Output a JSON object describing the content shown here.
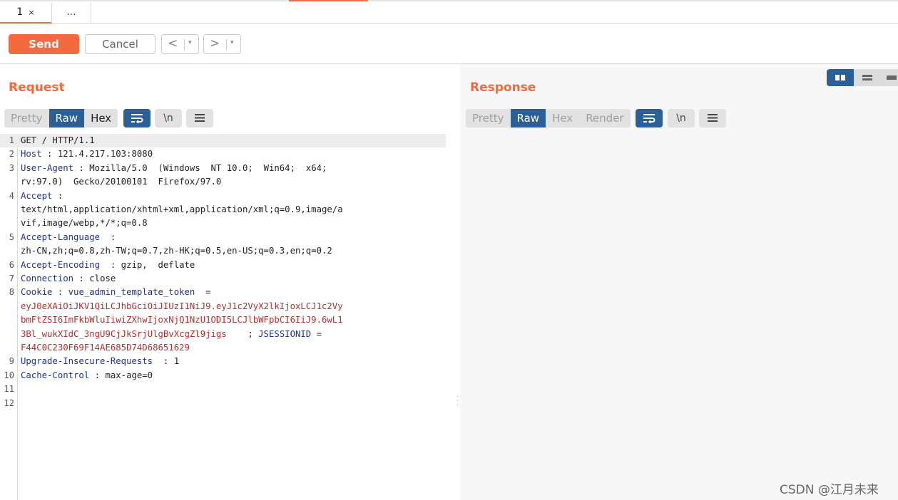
{
  "tabs": [
    {
      "label": "1",
      "close": "×"
    },
    {
      "label": "…"
    }
  ],
  "toolbar": {
    "send_label": "Send",
    "cancel_label": "Cancel",
    "prev_arrow": "<",
    "next_arrow": ">",
    "dropdown_glyph": "▾"
  },
  "request": {
    "title": "Request",
    "view_tabs": [
      "Pretty",
      "Raw",
      "Hex"
    ],
    "active_view": "Raw",
    "icons": [
      "wrap-lines-icon",
      "newline-icon",
      "menu-icon"
    ],
    "newline_glyph": "\\n",
    "lines": [
      {
        "n": "1",
        "key": "",
        "rest": "GET / HTTP/1.1"
      },
      {
        "n": "2",
        "key": "Host",
        "rest": " : 121.4.217.103:8080"
      },
      {
        "n": "3",
        "key": "User-Agent",
        "rest": " : Mozilla/5.0  (Windows  NT 10.0;  Win64;  x64;"
      },
      {
        "n": "",
        "key": "",
        "rest": "rv:97.0)  Gecko/20100101  Firefox/97.0"
      },
      {
        "n": "4",
        "key": "Accept",
        "rest": " :"
      },
      {
        "n": "",
        "key": "",
        "rest": "text/html,application/xhtml+xml,application/xml;q=0.9,image/a"
      },
      {
        "n": "",
        "key": "",
        "rest": "vif,image/webp,*/*;q=0.8"
      },
      {
        "n": "5",
        "key": "Accept-Language",
        "rest": "  :"
      },
      {
        "n": "",
        "key": "",
        "rest": "zh-CN,zh;q=0.8,zh-TW;q=0.7,zh-HK;q=0.5,en-US;q=0.3,en;q=0.2"
      },
      {
        "n": "6",
        "key": "Accept-Encoding",
        "rest": "  : gzip,  deflate"
      },
      {
        "n": "7",
        "key": "Connection",
        "rest": " : close"
      },
      {
        "n": "8",
        "key": "Cookie",
        "rest": " : ",
        "key2": "vue_admin_template_token",
        "rest2": "  ="
      },
      {
        "n": "",
        "red": "eyJ0eXAiOiJKV1QiLCJhbGciOiJIUzI1NiJ9.eyJ1c2VyX2lkIjoxLCJ1c2Vy"
      },
      {
        "n": "",
        "red": "bmFtZSI6ImFkbWluIiwiZXhwIjoxNjQ1NzU1ODI5LCJlbWFpbCI6IiJ9.6wL1"
      },
      {
        "n": "",
        "red": "3Bl_wukXIdC_3ngU9CjJkSrjUlgBvXcgZl9jigs",
        "rest": "    ; ",
        "key2": "JSESSIONID",
        "rest2": " ="
      },
      {
        "n": "",
        "red": "F44C0C230F69F14AE685D74D6865162​9"
      },
      {
        "n": "9",
        "key": "Upgrade-Insecure-Requests",
        "rest": "  : 1"
      },
      {
        "n": "10",
        "key": "Cache-Control",
        "rest": " : max-age=0"
      },
      {
        "n": "11",
        "key": "",
        "rest": ""
      },
      {
        "n": "12",
        "key": "",
        "rest": ""
      }
    ]
  },
  "response": {
    "title": "Response",
    "view_tabs": [
      "Pretty",
      "Raw",
      "Hex",
      "Render"
    ],
    "active_view": "Raw",
    "newline_glyph": "\\n"
  },
  "watermark": "CSDN @江月未来",
  "colors": {
    "accent": "#f26a3d",
    "active_blue": "#2c5f96",
    "header_key": "#23348c",
    "cookie_value": "#b03030"
  }
}
